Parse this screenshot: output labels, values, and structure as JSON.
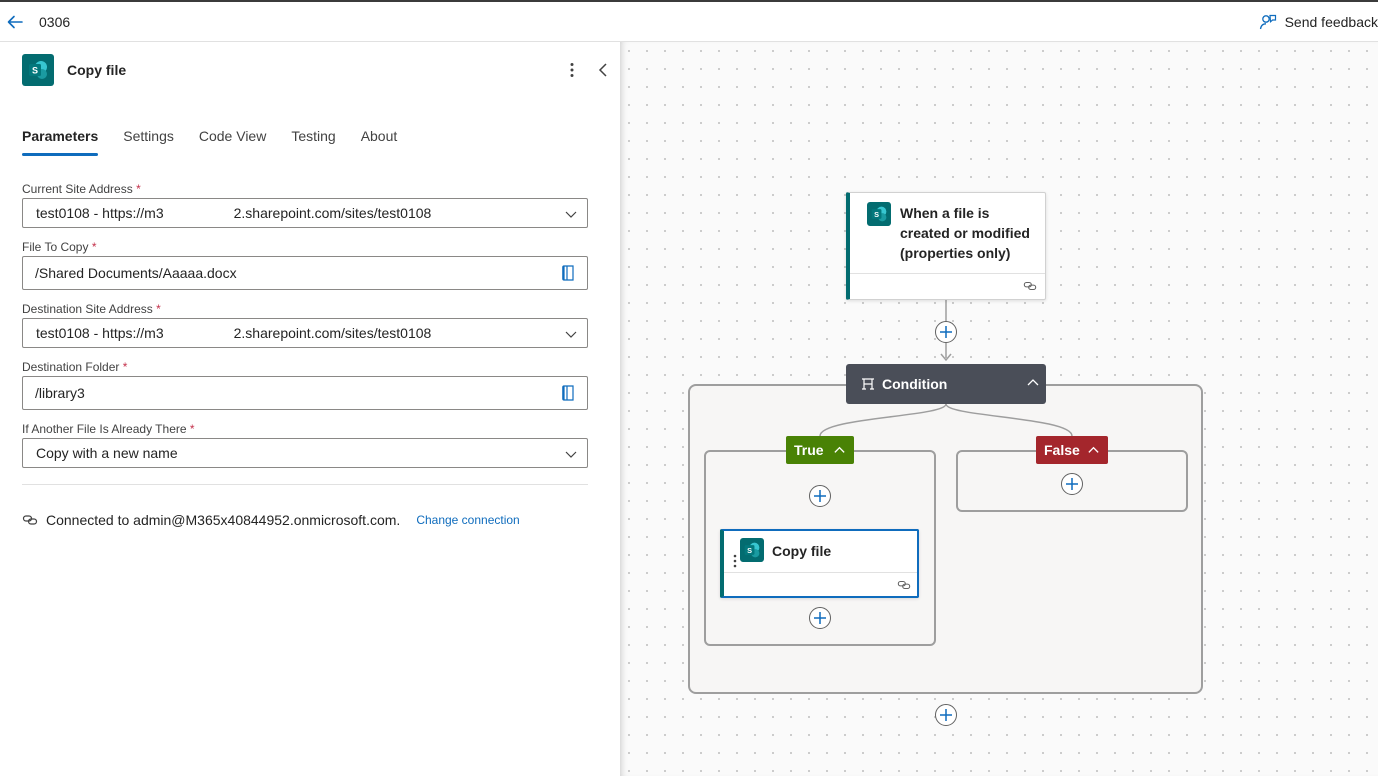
{
  "topbar": {
    "flow_name": "0306",
    "feedback_label": "Send feedback"
  },
  "panel": {
    "title": "Copy file",
    "tabs": [
      {
        "label": "Parameters",
        "active": true
      },
      {
        "label": "Settings",
        "active": false
      },
      {
        "label": "Code View",
        "active": false
      },
      {
        "label": "Testing",
        "active": false
      },
      {
        "label": "About",
        "active": false
      }
    ],
    "fields": {
      "current_site": {
        "label": "Current Site Address",
        "required": "*",
        "value": "test0108 - https://m3                  2.sharepoint.com/sites/test0108"
      },
      "file_to_copy": {
        "label": "File To Copy",
        "required": "*",
        "value": "/Shared Documents/Aaaaa.docx"
      },
      "dest_site": {
        "label": "Destination Site Address",
        "required": "*",
        "value": "test0108 - https://m3                  2.sharepoint.com/sites/test0108"
      },
      "dest_folder": {
        "label": "Destination Folder",
        "required": "*",
        "value": "/library3"
      },
      "if_exists": {
        "label": "If Another File Is Already There",
        "required": "*",
        "value": "Copy with a new name"
      }
    },
    "connection": {
      "text": "Connected to admin@M365x40844952.onmicrosoft.com.",
      "change_label": "Change connection"
    }
  },
  "canvas": {
    "trigger_title": "When a file is created or modified (properties only)",
    "condition_label": "Condition",
    "true_label": "True",
    "false_label": "False",
    "action_title": "Copy file"
  },
  "colors": {
    "accent": "#0f6cbd",
    "sharepoint": "#036c70",
    "condition_header": "#4a4e58",
    "true_branch": "#498205",
    "false_branch": "#a4262c",
    "required": "#c4314b"
  },
  "icons": [
    "back-arrow-icon",
    "feedback-icon",
    "sharepoint-icon",
    "more-icon",
    "collapse-icon",
    "chevron-down-icon",
    "file-picker-icon",
    "link-icon",
    "condition-icon",
    "chevron-up-icon",
    "plus-icon"
  ]
}
